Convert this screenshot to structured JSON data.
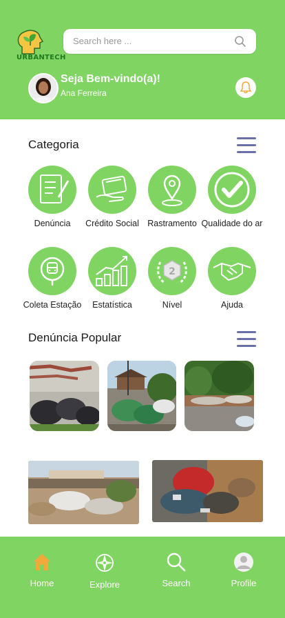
{
  "header": {
    "logo_text": "URBANTECH",
    "search_placeholder": "Search here ...",
    "welcome": "Seja Bem-vindo(a)!",
    "user_name": "Ana Ferreira"
  },
  "categoria": {
    "title": "Categoria",
    "items": [
      {
        "label": "Denúncia",
        "icon": "report-form-icon"
      },
      {
        "label": "Crédito Social",
        "icon": "credit-card-icon"
      },
      {
        "label": "Rastramento",
        "icon": "location-pin-icon"
      },
      {
        "label": "Qualidade do ar",
        "icon": "check-icon"
      },
      {
        "label": "Coleta Estação",
        "icon": "train-station-icon"
      },
      {
        "label": "Estatística",
        "icon": "bar-chart-icon"
      },
      {
        "label": "Nível",
        "icon": "level-badge-icon"
      },
      {
        "label": "Ajuda",
        "icon": "handshake-icon"
      }
    ]
  },
  "popular": {
    "title": "Denúncia Popular",
    "photos": [
      "trash-pile-photo",
      "trash-street-photo",
      "trash-roadside-photo",
      "trash-lot-photo",
      "trash-closeup-photo"
    ]
  },
  "nav": {
    "items": [
      {
        "label": "Home",
        "icon": "home-icon"
      },
      {
        "label": "Explore",
        "icon": "compass-icon"
      },
      {
        "label": "Search",
        "icon": "search-icon"
      },
      {
        "label": "Profile",
        "icon": "profile-icon"
      }
    ]
  },
  "colors": {
    "primary": "#80d462",
    "menu": "#6b6fa8",
    "home_active": "#f2a93b"
  }
}
